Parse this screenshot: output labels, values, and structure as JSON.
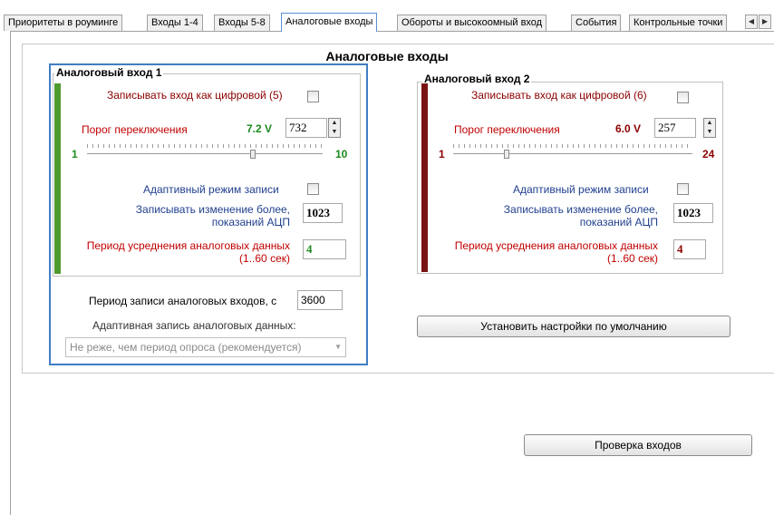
{
  "tabs": [
    {
      "label": "Приоритеты в роуминге"
    },
    {
      "label": "Входы 1-4"
    },
    {
      "label": "Входы 5-8"
    },
    {
      "label": "Аналоговые входы"
    },
    {
      "label": "Обороты и высокоомный вход"
    },
    {
      "label": "События"
    },
    {
      "label": "Контрольные точки"
    }
  ],
  "tab_scroll": {
    "left": "◀",
    "right": "▶"
  },
  "page_title": "Аналоговые входы",
  "input1": {
    "title": "Аналоговый вход 1",
    "record_as_digital": "Записывать вход как цифровой (5)",
    "threshold_label": "Порог переключения",
    "threshold_voltage": "7.2 V",
    "threshold_value": "732",
    "slider_min": "1",
    "slider_max": "10",
    "adaptive_mode": "Адаптивный режим записи",
    "record_change_line1": "Записывать изменение более,",
    "record_change_line2": "показаний АЦП",
    "record_change_value": "1023",
    "avg_period_line1": "Период усреднения аналоговых данных",
    "avg_period_line2": "(1..60 сек)",
    "avg_period_value": "4",
    "strip_color": "#4f9a2e"
  },
  "input2": {
    "title": "Аналоговый вход 2",
    "record_as_digital": "Записывать вход как цифровой (6)",
    "threshold_label": "Порог переключения",
    "threshold_voltage": "6.0 V",
    "threshold_value": "257",
    "slider_min": "1",
    "slider_max": "24",
    "adaptive_mode": "Адаптивный режим записи",
    "record_change_line1": "Записывать изменение более,",
    "record_change_line2": "показаний АЦП",
    "record_change_value": "1023",
    "avg_period_line1": "Период усреднения аналоговых данных",
    "avg_period_line2": "(1..60 сек)",
    "avg_period_value": "4",
    "strip_color": "#7a1414"
  },
  "record_period_label": "Период записи аналоговых входов, с",
  "record_period_value": "3600",
  "adaptive_record_label": "Адаптивная запись аналоговых данных:",
  "adaptive_record_selected": "Не реже, чем период опроса (рекомендуется)",
  "defaults_button": "Установить настройки по умолчанию",
  "check_inputs_button": "Проверка входов",
  "colors": {
    "accent": "#3f7ec4",
    "voltage1": "#1e8a1e",
    "voltage2": "#8b0000"
  }
}
